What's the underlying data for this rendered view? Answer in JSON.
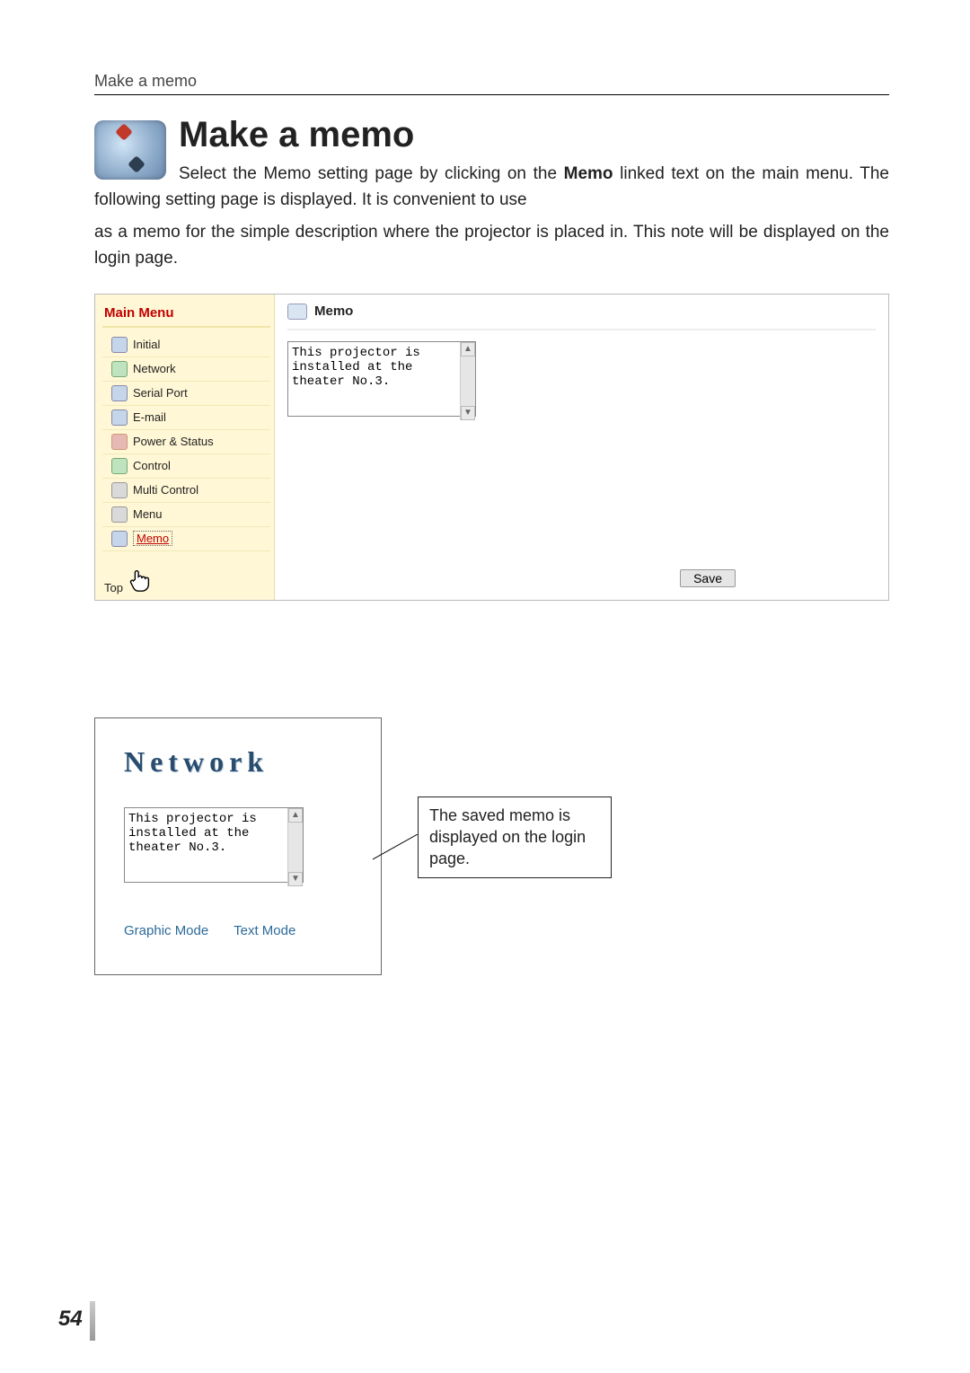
{
  "running_head": "Make a memo",
  "title": "Make a memo",
  "intro_line1": "Select the Memo setting page by clicking on the ",
  "intro_emphasis": "Memo",
  "intro_line1_tail": " linked text on the main menu. The following setting page is displayed. It is convenient to use",
  "intro_line2": "as a memo for the simple description where the projector is placed in. This note will be displayed on the login page.",
  "panel": {
    "sidebar_header": "Main Menu",
    "items": [
      {
        "label": "Initial",
        "icon": "blue"
      },
      {
        "label": "Network",
        "icon": "green"
      },
      {
        "label": "Serial Port",
        "icon": "blue"
      },
      {
        "label": "E-mail",
        "icon": "blue"
      },
      {
        "label": "Power & Status",
        "icon": "red"
      },
      {
        "label": "Control",
        "icon": "green"
      },
      {
        "label": "Multi Control",
        "icon": "gray"
      },
      {
        "label": "Menu",
        "icon": "gray"
      }
    ],
    "active_item_label": "Memo",
    "footer_top": "Top",
    "content_header": "Memo",
    "memo_value": "This projector is\ninstalled at the\ntheater No.3.",
    "save_label": "Save"
  },
  "login": {
    "logo": "Network",
    "memo_value": "This projector is\ninstalled at the\ntheater No.3.",
    "mode_graphic": "Graphic Mode",
    "mode_text": "Text Mode"
  },
  "callout": "The saved memo is displayed on the login page.",
  "page_number": "54"
}
